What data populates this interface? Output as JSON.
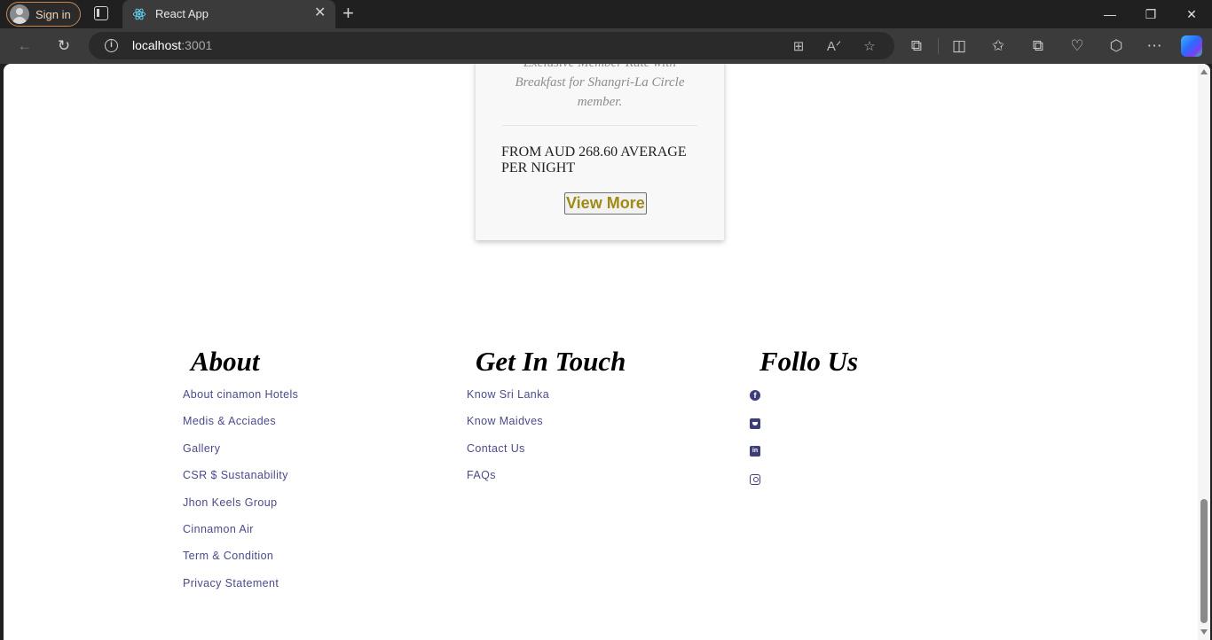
{
  "browser": {
    "signin_label": "Sign in",
    "tab_title": "React App",
    "url_host": "localhost",
    "url_port": ":3001"
  },
  "card": {
    "description_line1": "Exclusive Member Rate with",
    "description_line2": "Breakfast for Shangri-La Circle",
    "description_line3": "member.",
    "price_text": "FROM AUD 268.60 AVERAGE PER NIGHT",
    "view_more_label": "View More"
  },
  "footer": {
    "about": {
      "heading": "About",
      "links": [
        "About cinamon Hotels",
        "Medis & Acciades",
        "Gallery",
        "CSR $ Sustanability",
        "Jhon Keels Group",
        "Cinnamon Air",
        "Term & Condition",
        "Privacy Statement"
      ]
    },
    "contact": {
      "heading": "Get In Touch",
      "links": [
        "Know Sri Lanka",
        "Know Maidves",
        "Contact Us",
        "FAQs"
      ]
    },
    "follow": {
      "heading": "Follo Us",
      "icons": [
        "facebook-icon",
        "twitter-icon",
        "linkedin-icon",
        "instagram-icon"
      ]
    }
  },
  "colors": {
    "link": "#4b4a8c",
    "button_text": "#a08a14",
    "social_icon": "#3d3d7a"
  }
}
